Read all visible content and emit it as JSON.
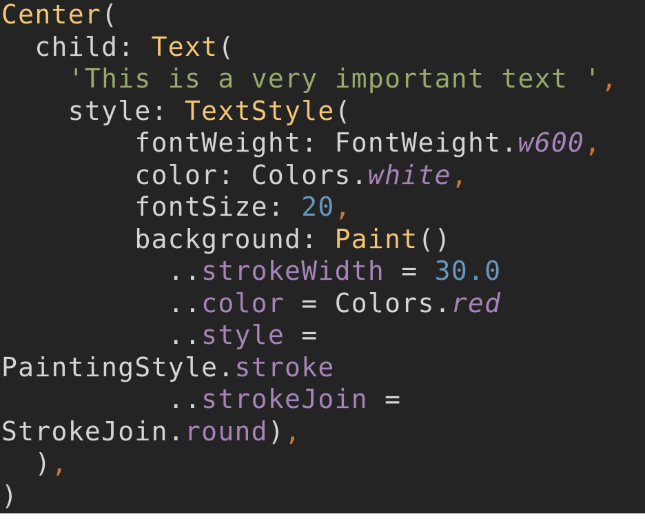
{
  "editor": {
    "language": "dart",
    "colors": {
      "background": "#242424",
      "plain": "#d4d4d4",
      "class_name": "#f2c675",
      "string": "#98a96b",
      "punctuation_comma": "#cc7832",
      "number": "#6897bb",
      "member": "#a684b7"
    },
    "lines": [
      [
        {
          "text": "Center",
          "kind": "class"
        },
        {
          "text": "(",
          "kind": "plain"
        }
      ],
      [
        {
          "text": "  child: ",
          "kind": "plain"
        },
        {
          "text": "Text",
          "kind": "class"
        },
        {
          "text": "(",
          "kind": "plain"
        }
      ],
      [
        {
          "text": "    ",
          "kind": "plain"
        },
        {
          "text": "'This is a very important text '",
          "kind": "string"
        },
        {
          "text": ",",
          "kind": "comma"
        }
      ],
      [
        {
          "text": "    style: ",
          "kind": "plain"
        },
        {
          "text": "TextStyle",
          "kind": "class"
        },
        {
          "text": "(",
          "kind": "plain"
        }
      ],
      [
        {
          "text": "        fontWeight: FontWeight.",
          "kind": "plain"
        },
        {
          "text": "w600",
          "kind": "italic"
        },
        {
          "text": ",",
          "kind": "comma"
        }
      ],
      [
        {
          "text": "        color: Colors.",
          "kind": "plain"
        },
        {
          "text": "white",
          "kind": "italic"
        },
        {
          "text": ",",
          "kind": "comma"
        }
      ],
      [
        {
          "text": "        fontSize: ",
          "kind": "plain"
        },
        {
          "text": "20",
          "kind": "number"
        },
        {
          "text": ",",
          "kind": "comma"
        }
      ],
      [
        {
          "text": "        background: ",
          "kind": "plain"
        },
        {
          "text": "Paint",
          "kind": "class"
        },
        {
          "text": "()",
          "kind": "plain"
        }
      ],
      [
        {
          "text": "          ..",
          "kind": "plain"
        },
        {
          "text": "strokeWidth",
          "kind": "member"
        },
        {
          "text": " = ",
          "kind": "plain"
        },
        {
          "text": "30.0",
          "kind": "number"
        }
      ],
      [
        {
          "text": "          ..",
          "kind": "plain"
        },
        {
          "text": "color",
          "kind": "member"
        },
        {
          "text": " = Colors.",
          "kind": "plain"
        },
        {
          "text": "red",
          "kind": "italic"
        }
      ],
      [
        {
          "text": "          ..",
          "kind": "plain"
        },
        {
          "text": "style",
          "kind": "member"
        },
        {
          "text": " =",
          "kind": "plain"
        }
      ],
      [
        {
          "text": "PaintingStyle.",
          "kind": "plain"
        },
        {
          "text": "stroke",
          "kind": "member"
        }
      ],
      [
        {
          "text": "          ..",
          "kind": "plain"
        },
        {
          "text": "strokeJoin",
          "kind": "member"
        },
        {
          "text": " =",
          "kind": "plain"
        }
      ],
      [
        {
          "text": "StrokeJoin.",
          "kind": "plain"
        },
        {
          "text": "round",
          "kind": "member"
        },
        {
          "text": ")",
          "kind": "plain"
        },
        {
          "text": ",",
          "kind": "comma"
        }
      ],
      [
        {
          "text": "  )",
          "kind": "plain"
        },
        {
          "text": ",",
          "kind": "comma"
        }
      ],
      [
        {
          "text": ")",
          "kind": "plain"
        }
      ]
    ]
  }
}
